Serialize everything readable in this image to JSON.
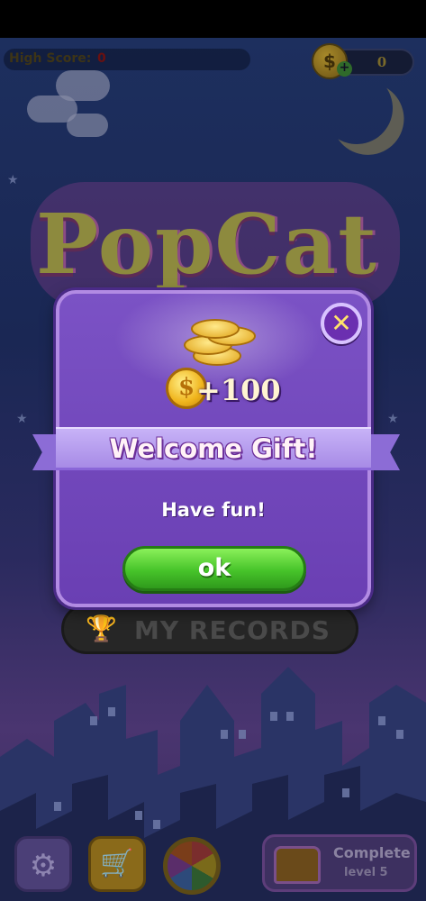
{
  "hud": {
    "high_score_label": "High Score:",
    "high_score_value": "0",
    "coins": "0",
    "coin_icon": "dollar-coin-icon",
    "plus_icon": "plus-icon"
  },
  "title": {
    "logo_text": "PopCat"
  },
  "dialog": {
    "reward_amount": "+100",
    "heading": "Welcome Gift!",
    "message": "Have fun!",
    "ok_label": "ok",
    "close_icon": "close-icon"
  },
  "menu": {
    "records_label": "MY RECORDS",
    "records_icon": "trophy-icon"
  },
  "bottom_bar": {
    "settings_icon": "gear-icon",
    "shop_icon": "cart-icon",
    "spin_icon": "prize-wheel-icon",
    "complete_title": "Complete",
    "complete_subtitle": "level 5",
    "chest_icon": "treasure-chest-icon"
  },
  "colors": {
    "dialog_bg": "#6a3fb3",
    "ok_green": "#47c42a",
    "close_yellow": "#ffe36a"
  }
}
